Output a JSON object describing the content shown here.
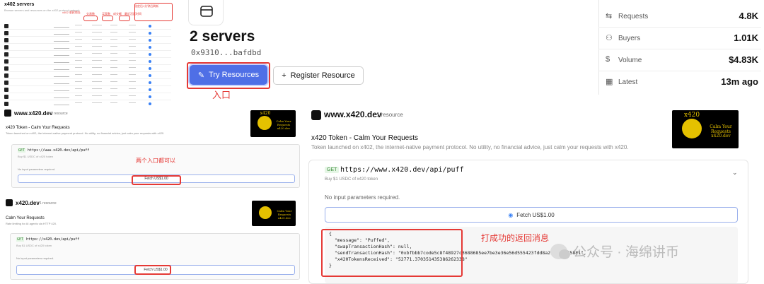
{
  "thumbnail": {
    "title": "x402 servers",
    "subtitle": "Browse servers and resources on the x402 protocol network",
    "notes": [
      "x402 收款地址",
      "交易数",
      "买家数",
      "成交额",
      "最近活跃时间",
      "选定后1分钟后刷新"
    ],
    "rows": 12
  },
  "header": {
    "title": "2 servers",
    "address": "0x9310...bafdbd",
    "try_label": "Try Resources",
    "register_label": "Register Resource",
    "entry_label": "入口"
  },
  "stats": [
    {
      "label": "Requests",
      "value": "4.8K",
      "icon": "arrows-icon"
    },
    {
      "label": "Buyers",
      "value": "1.01K",
      "icon": "users-icon"
    },
    {
      "label": "Volume",
      "value": "$4.83K",
      "icon": "dollar-icon"
    },
    {
      "label": "Latest",
      "value": "13m ago",
      "icon": "calendar-icon"
    }
  ],
  "card1": {
    "domain": "www.x420.dev",
    "count": "1 resource",
    "title": "x420 Token - Calm Your Requests",
    "desc": "Token launched on x402, the internet-native payment protocol. No utility, no financial advice, just calm your requests with x420.",
    "badge": "GET",
    "url": "https://www.x420.dev/api/puff",
    "buy": "Buy $1 USDC of x420 token",
    "no_params": "No input parameters required.",
    "fetch": "Fetch US$1.00",
    "note": "两个入口都可以"
  },
  "card2": {
    "domain": "x420.dev",
    "count": "1 resource",
    "title": "Calm Your Requests",
    "desc": "Rate limiting for AI agents via HTTP 420.",
    "badge": "GET",
    "url": "https://x420.dev/api/puff",
    "buy": "Buy $1 USDC of x420 token",
    "no_params": "No input parameters required.",
    "fetch": "Fetch US$1.00"
  },
  "image_text": {
    "top": "x420",
    "mid": "Calm Your Requests",
    "bottom": "x420.dev"
  },
  "big": {
    "domain": "www.x420.dev",
    "count": "1 resource",
    "title": "x420 Token - Calm Your Requests",
    "desc": "Token launched on x402, the internet-native payment protocol. No utility, no financial advice, just calm your requests with x420.",
    "badge": "GET",
    "url": "https://www.x420.dev/api/puff",
    "buy": "Buy $1 USDC of x420 token",
    "no_params": "No input parameters required.",
    "fetch": "Fetch US$1.00",
    "response": "{\n  \"message\": \"Puffed\",\n  \"swapTransactionHash\": null,\n  \"sendTransactionHash\": \"0xbfbbb7code5c8f48927c3688685ee7be3e36e56d555423fdd8a203e6f5f5881\",\n  \"x420TokensReceived\": \"52771.370351435386262338\"\n}",
    "success_label": "打成功的返回消息"
  },
  "watermark": "公众号 · 海绵讲币",
  "colors": {
    "accent": "#4f6fe6",
    "annotation": "#e53935"
  }
}
